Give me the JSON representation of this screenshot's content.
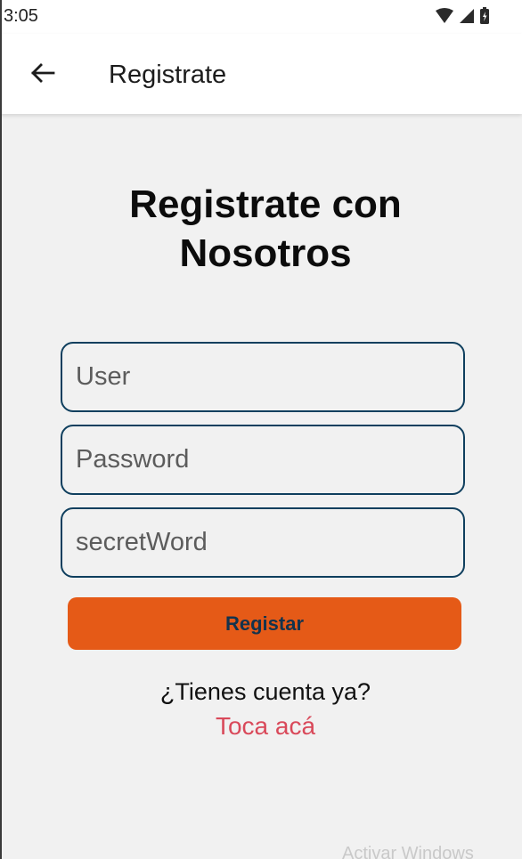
{
  "status_bar": {
    "time": "3:05",
    "icons": [
      "wifi-icon",
      "cell-signal-icon",
      "battery-icon"
    ]
  },
  "app_bar": {
    "title": "Registrate",
    "back_icon": "arrow-left-icon"
  },
  "main": {
    "heading_line1": "Registrate con",
    "heading_line2": "Nosotros",
    "fields": {
      "user": {
        "placeholder": "User",
        "value": ""
      },
      "password": {
        "placeholder": "Password",
        "value": ""
      },
      "secret_word": {
        "placeholder": "secretWord",
        "value": ""
      }
    },
    "register_button_label": "Registar",
    "question_text": "¿Tienes cuenta ya?",
    "login_link_text": "Toca acá"
  },
  "watermark": "Activar Windows",
  "colors": {
    "accent": "#e55a17",
    "field_border": "#0f3f5e",
    "button_text": "#13334d",
    "link": "#d9495a",
    "background": "#f1f1f1"
  }
}
